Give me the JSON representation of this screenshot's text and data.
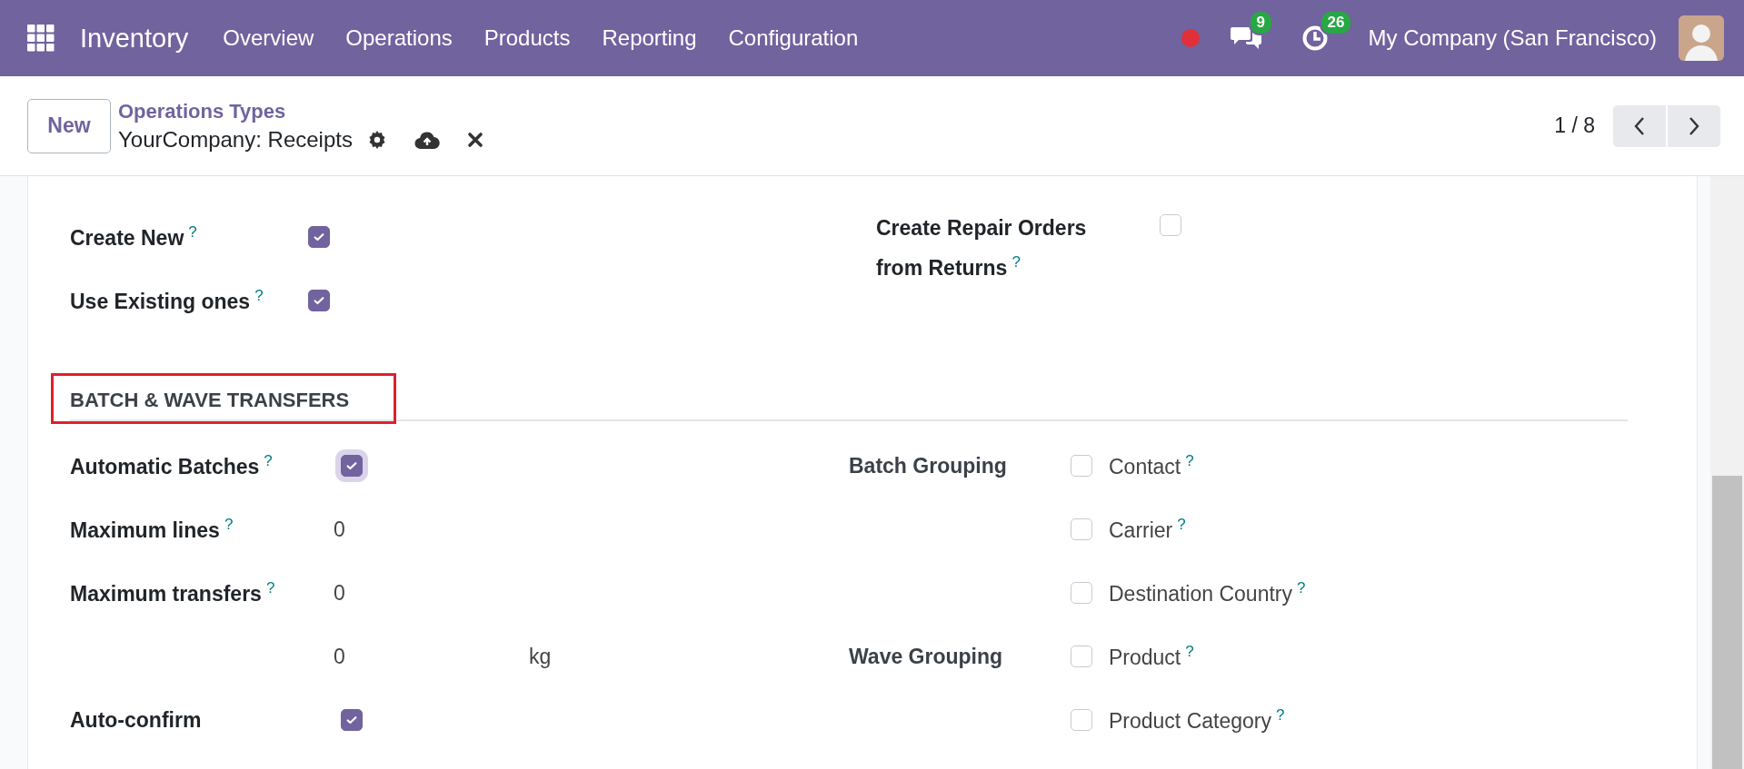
{
  "navbar": {
    "app_name": "Inventory",
    "menu": [
      "Overview",
      "Operations",
      "Products",
      "Reporting",
      "Configuration"
    ],
    "messages_count": "9",
    "activities_count": "26",
    "company": "My Company (San Francisco)"
  },
  "control_panel": {
    "new_button": "New",
    "breadcrumb": "Operations Types",
    "record_title": "YourCompany: Receipts",
    "pager": "1 / 8"
  },
  "top_fields": {
    "left": [
      {
        "label": "Create New",
        "help": "?",
        "checked": true
      },
      {
        "label": "Use Existing ones",
        "help": "?",
        "checked": true
      }
    ],
    "right": [
      {
        "label": "Create Repair Orders from Returns",
        "help": "?",
        "checked": false
      }
    ]
  },
  "batch_wave": {
    "heading": "BATCH & WAVE TRANSFERS",
    "highlighted": true,
    "left": [
      {
        "kind": "checkbox",
        "label": "Automatic Batches",
        "help": "?",
        "checked": true,
        "focused": true
      },
      {
        "kind": "number",
        "label": "Maximum lines",
        "help": "?",
        "value": "0"
      },
      {
        "kind": "number",
        "label": "Maximum transfers",
        "help": "?",
        "value": "0"
      },
      {
        "kind": "weight",
        "value": "0",
        "unit": "kg"
      },
      {
        "kind": "checkbox",
        "label": "Auto-confirm",
        "checked": true,
        "focused": false
      }
    ],
    "groupings": [
      {
        "label": "Batch Grouping",
        "options": [
          {
            "label": "Contact",
            "help": "?",
            "checked": false
          },
          {
            "label": "Carrier",
            "help": "?",
            "checked": false
          },
          {
            "label": "Destination Country",
            "help": "?",
            "checked": false
          }
        ]
      },
      {
        "label": "Wave Grouping",
        "options": [
          {
            "label": "Product",
            "help": "?",
            "checked": false
          },
          {
            "label": "Product Category",
            "help": "?",
            "checked": false
          }
        ]
      }
    ]
  }
}
